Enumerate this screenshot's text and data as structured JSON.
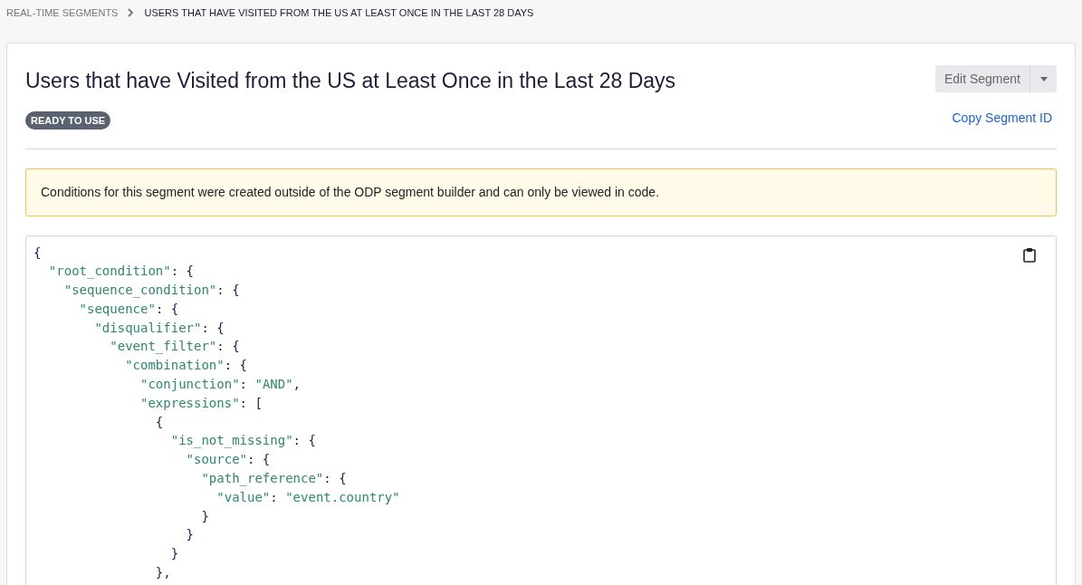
{
  "breadcrumb": [
    {
      "label": "REAL-TIME SEGMENTS",
      "current": false
    },
    {
      "label": "USERS THAT HAVE VISITED FROM THE US AT LEAST ONCE IN THE LAST 28 DAYS",
      "current": true
    }
  ],
  "title": "Users that have Visited from the US at Least Once in the Last 28 Days",
  "status_badge": "READY TO USE",
  "edit_button": "Edit Segment",
  "copy_link": "Copy Segment ID",
  "notice": "Conditions for this segment were created outside of the ODP segment builder and can only be viewed in code.",
  "code_lines": [
    "{",
    "  \"root_condition\": {",
    "    \"sequence_condition\": {",
    "      \"sequence\": {",
    "        \"disqualifier\": {",
    "          \"event_filter\": {",
    "            \"combination\": {",
    "              \"conjunction\": \"AND\",",
    "              \"expressions\": [",
    "                {",
    "                  \"is_not_missing\": {",
    "                    \"source\": {",
    "                      \"path_reference\": {",
    "                        \"value\": \"event.country\"",
    "                      }",
    "                    }",
    "                  }",
    "                },"
  ]
}
